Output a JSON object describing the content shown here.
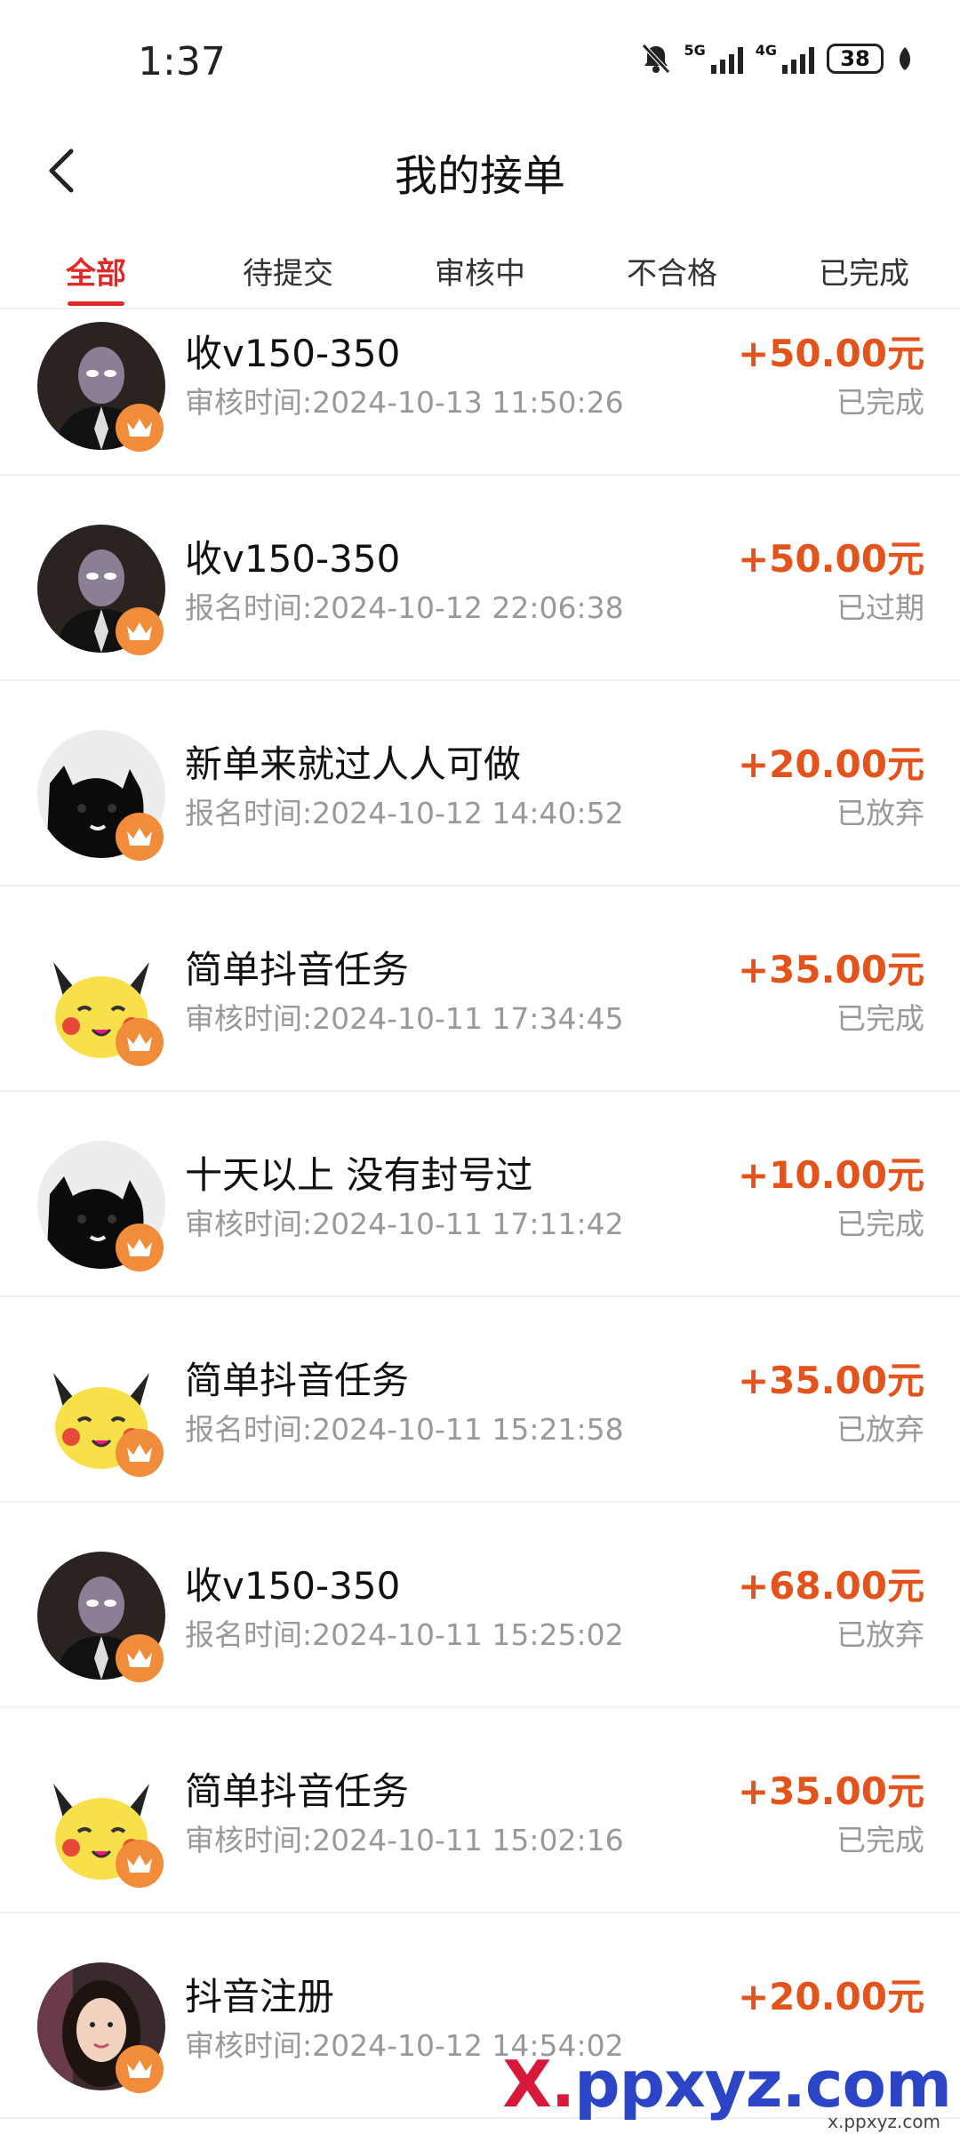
{
  "status_bar": {
    "time": "1:37",
    "net1": "5G",
    "net2": "4G",
    "battery": "38"
  },
  "header": {
    "title": "我的接单"
  },
  "tabs": [
    {
      "label": "全部",
      "active": true
    },
    {
      "label": "待提交",
      "active": false
    },
    {
      "label": "审核中",
      "active": false
    },
    {
      "label": "不合格",
      "active": false
    },
    {
      "label": "已完成",
      "active": false
    }
  ],
  "orders": [
    {
      "avatar": "masked-figure-avatar",
      "title": "收v150-350",
      "time": "审核时间:2024-10-13 11:50:26",
      "amount": "+50.00元",
      "status": "已完成"
    },
    {
      "avatar": "masked-figure-avatar",
      "title": "收v150-350",
      "time": "报名时间:2024-10-12 22:06:38",
      "amount": "+50.00元",
      "status": "已过期"
    },
    {
      "avatar": "black-cat-avatar",
      "title": "新单来就过人人可做",
      "time": "报名时间:2024-10-12 14:40:52",
      "amount": "+20.00元",
      "status": "已放弃"
    },
    {
      "avatar": "pikachu-avatar",
      "title": "简单抖音任务",
      "time": "审核时间:2024-10-11 17:34:45",
      "amount": "+35.00元",
      "status": "已完成"
    },
    {
      "avatar": "black-cat-avatar",
      "title": "十天以上 没有封号过",
      "time": "审核时间:2024-10-11 17:11:42",
      "amount": "+10.00元",
      "status": "已完成"
    },
    {
      "avatar": "pikachu-avatar",
      "title": "简单抖音任务",
      "time": "报名时间:2024-10-11 15:21:58",
      "amount": "+35.00元",
      "status": "已放弃"
    },
    {
      "avatar": "masked-figure-avatar",
      "title": "收v150-350",
      "time": "报名时间:2024-10-11 15:25:02",
      "amount": "+68.00元",
      "status": "已放弃"
    },
    {
      "avatar": "pikachu-avatar",
      "title": "简单抖音任务",
      "time": "审核时间:2024-10-11 15:02:16",
      "amount": "+35.00元",
      "status": "已完成"
    },
    {
      "avatar": "woman-photo-avatar",
      "title": "抖音注册",
      "time": "审核时间:2024-10-12 14:54:02",
      "amount": "+20.00元",
      "status": ""
    }
  ],
  "watermark": {
    "main_a": "X.",
    "main_b": "ppxyz.com",
    "sub": "x.ppxyz.com"
  },
  "colors": {
    "accent": "#e02a2a",
    "amount": "#e2541c",
    "crown": "#f08c3a",
    "muted": "#999999"
  }
}
